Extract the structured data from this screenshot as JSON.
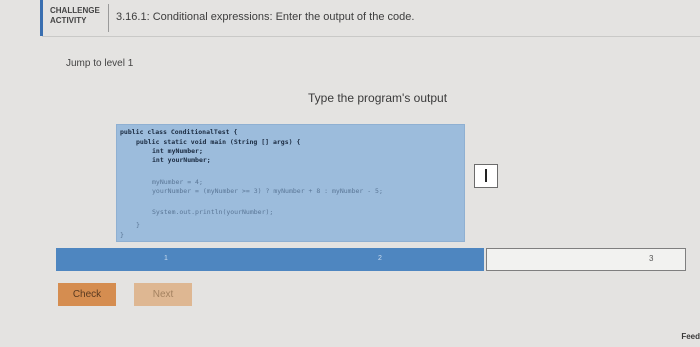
{
  "header": {
    "badge": "CHALLENGE\nACTIVITY",
    "title": "3.16.1: Conditional expressions: Enter the output of the code."
  },
  "jump_link": "Jump to level 1",
  "instruction": "Type the program's output",
  "code": {
    "line1": "public class ConditionalTest {",
    "line2": "public static void main (String [] args) {",
    "line3": "int myNumber;",
    "line4": "int yourNumber;",
    "line5": "myNumber = 4;",
    "line6": "yourNumber = (myNumber >= 3) ? myNumber + 8 : myNumber - 5;",
    "line7": "System.out.println(yourNumber);",
    "line8": "}",
    "line9": "}"
  },
  "answer": {
    "value": ""
  },
  "levels": {
    "items": [
      "1",
      "2",
      "3"
    ],
    "current": 3
  },
  "buttons": {
    "check": "Check",
    "next": "Next"
  },
  "feedback": "Feed",
  "colors": {
    "accent": "#3a6fb0",
    "code_bg": "#9cbcdc",
    "level_fill": "#4e86c0",
    "check_button": "#d58d50",
    "next_button": "#deb792"
  }
}
